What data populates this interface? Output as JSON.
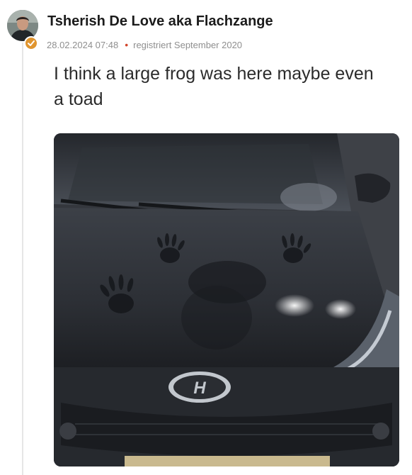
{
  "post": {
    "author": {
      "name": "Tsherish De Love aka Flachzange",
      "avatar_icon": "avatar-portrait",
      "badge_icon": "verified-check-icon",
      "badge_color": "#e0952f"
    },
    "timestamp": "28.02.2024 07:48",
    "separator": "•",
    "registered": "registriert September 2020",
    "text": "I think a large frog was here maybe even a toad",
    "image": {
      "icon": "car-hood-photo",
      "logo_text": "H"
    }
  }
}
